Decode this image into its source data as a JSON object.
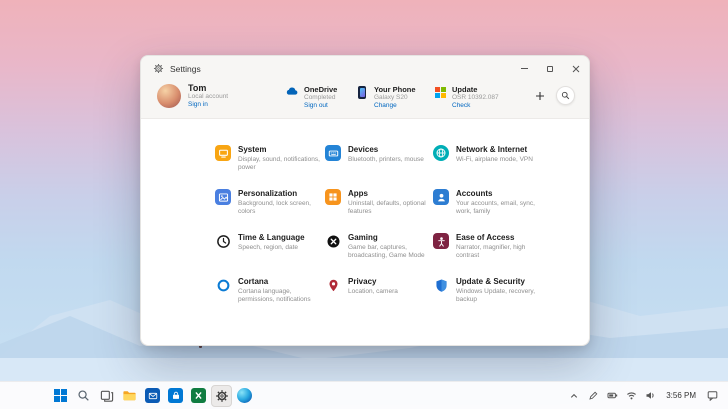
{
  "window": {
    "title": "Settings"
  },
  "header": {
    "profile": {
      "name": "Tom",
      "subtitle": "Local account",
      "link": "Sign in",
      "icon": "avatar"
    },
    "cards": [
      {
        "title": "OneDrive",
        "subtitle": "Completed",
        "link": "Sign out",
        "icon": "onedrive-cloud-icon"
      },
      {
        "title": "Your Phone",
        "subtitle": "Galaxy S20",
        "link": "Change",
        "icon": "your-phone-icon"
      },
      {
        "title": "Update",
        "subtitle": "OSR 10392.087",
        "link": "Check",
        "icon": "windows-update-icon"
      }
    ],
    "actions": {
      "add": "add-button",
      "search": "search-button"
    }
  },
  "categories": [
    {
      "title": "System",
      "subtitle": "Display, sound, notifications, power",
      "icon": "system-icon",
      "color": "#f8a513"
    },
    {
      "title": "Devices",
      "subtitle": "Bluetooth, printers, mouse",
      "icon": "devices-icon",
      "color": "#2484d6"
    },
    {
      "title": "Network & Internet",
      "subtitle": "Wi-Fi, airplane mode, VPN",
      "icon": "network-internet-icon",
      "color": "#00aeb6"
    },
    {
      "title": "Personalization",
      "subtitle": "Background, lock screen, colors",
      "icon": "personalization-icon",
      "color": "#4a7fe0"
    },
    {
      "title": "Apps",
      "subtitle": "Uninstall, defaults, optional features",
      "icon": "apps-icon",
      "color": "#f7941d"
    },
    {
      "title": "Accounts",
      "subtitle": "Your accounts, email, sync, work, family",
      "icon": "accounts-icon",
      "color": "#2d7dd2"
    },
    {
      "title": "Time & Language",
      "subtitle": "Speech, region, date",
      "icon": "time-language-icon",
      "color": "transparent"
    },
    {
      "title": "Gaming",
      "subtitle": "Game bar, captures, broadcasting, Game Mode",
      "icon": "gaming-icon",
      "color": "transparent"
    },
    {
      "title": "Ease of Access",
      "subtitle": "Narrator, magnifier, high contrast",
      "icon": "ease-of-access-icon",
      "color": "#7e2342"
    },
    {
      "title": "Cortana",
      "subtitle": "Cortana language, permissions, notifications",
      "icon": "cortana-icon",
      "color": "transparent"
    },
    {
      "title": "Privacy",
      "subtitle": "Location, camera",
      "icon": "privacy-icon",
      "color": "transparent"
    },
    {
      "title": "Update & Security",
      "subtitle": "Windows Update, recovery, backup",
      "icon": "update-security-icon",
      "color": "transparent"
    }
  ],
  "taskbar": {
    "time": "3:56 PM",
    "left_icons": [
      "start-icon",
      "search-icon",
      "task-view-icon",
      "file-explorer-icon",
      "mail-icon",
      "store-icon",
      "excel-icon",
      "settings-icon",
      "edge-icon"
    ],
    "tray_icons": [
      "chevron-up-icon",
      "pen-icon",
      "battery-icon",
      "wifi-icon",
      "volume-icon",
      "action-center-icon"
    ]
  },
  "colors": {
    "accent": "#0067c0",
    "link": "#0067c0"
  }
}
